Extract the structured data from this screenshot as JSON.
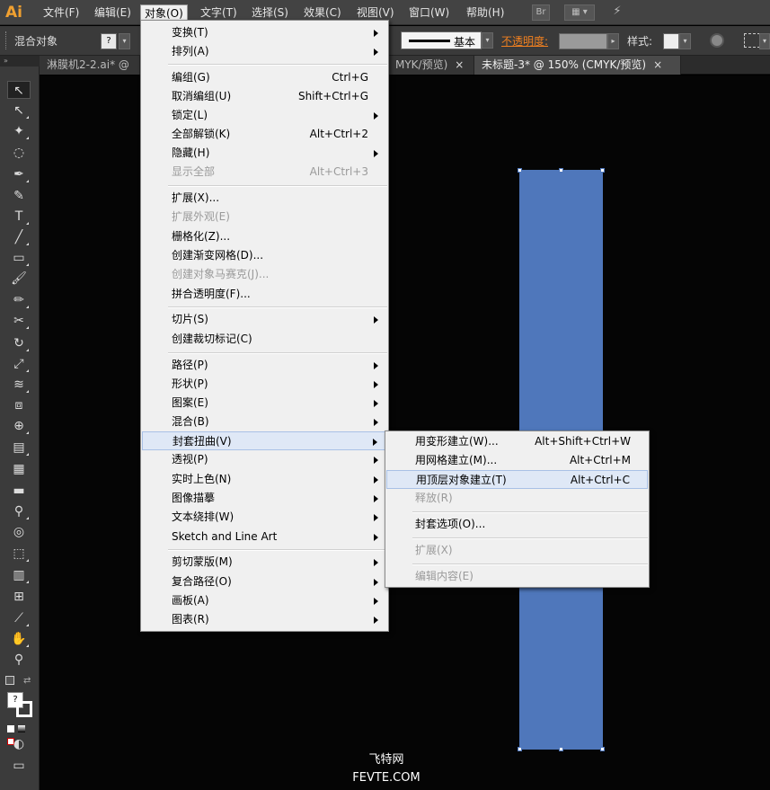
{
  "app": {
    "logo": "Ai"
  },
  "menubar": {
    "items": [
      "文件(F)",
      "编辑(E)",
      "对象(O)",
      "文字(T)",
      "选择(S)",
      "效果(C)",
      "视图(V)",
      "窗口(W)",
      "帮助(H)"
    ],
    "bridge_label": "Br"
  },
  "controlbar": {
    "selection_label": "混合对象",
    "stroke_profile": "基本",
    "opacity_label": "不透明度:",
    "style_label": "样式:"
  },
  "tabs": [
    {
      "label": "淋膜机2-2.ai* @"
    },
    {
      "label": "MYK/预览)",
      "close": "×"
    },
    {
      "label": "未标题-3* @ 150% (CMYK/预览)",
      "close": "×"
    }
  ],
  "object_menu": {
    "items": [
      {
        "label": "变换(T)",
        "submenu": true
      },
      {
        "label": "排列(A)",
        "submenu": true
      },
      {
        "label": "编组(G)",
        "shortcut": "Ctrl+G"
      },
      {
        "label": "取消编组(U)",
        "shortcut": "Shift+Ctrl+G"
      },
      {
        "label": "锁定(L)",
        "submenu": true
      },
      {
        "label": "全部解锁(K)",
        "shortcut": "Alt+Ctrl+2"
      },
      {
        "label": "隐藏(H)",
        "submenu": true
      },
      {
        "label": "显示全部",
        "shortcut": "Alt+Ctrl+3",
        "disabled": true
      },
      {
        "label": "扩展(X)..."
      },
      {
        "label": "扩展外观(E)",
        "disabled": true
      },
      {
        "label": "栅格化(Z)..."
      },
      {
        "label": "创建渐变网格(D)..."
      },
      {
        "label": "创建对象马赛克(J)...",
        "disabled": true
      },
      {
        "label": "拼合透明度(F)..."
      },
      {
        "label": "切片(S)",
        "submenu": true
      },
      {
        "label": "创建裁切标记(C)"
      },
      {
        "label": "路径(P)",
        "submenu": true
      },
      {
        "label": "形状(P)",
        "submenu": true
      },
      {
        "label": "图案(E)",
        "submenu": true
      },
      {
        "label": "混合(B)",
        "submenu": true
      },
      {
        "label": "封套扭曲(V)",
        "submenu": true,
        "highlighted": true
      },
      {
        "label": "透视(P)",
        "submenu": true
      },
      {
        "label": "实时上色(N)",
        "submenu": true
      },
      {
        "label": "图像描摹",
        "submenu": true
      },
      {
        "label": "文本绕排(W)",
        "submenu": true
      },
      {
        "label": "Sketch and Line Art",
        "submenu": true
      },
      {
        "label": "剪切蒙版(M)",
        "submenu": true
      },
      {
        "label": "复合路径(O)",
        "submenu": true
      },
      {
        "label": "画板(A)",
        "submenu": true
      },
      {
        "label": "图表(R)",
        "submenu": true
      }
    ]
  },
  "envelope_submenu": {
    "items": [
      {
        "label": "用变形建立(W)...",
        "shortcut": "Alt+Shift+Ctrl+W"
      },
      {
        "label": "用网格建立(M)...",
        "shortcut": "Alt+Ctrl+M"
      },
      {
        "label": "用顶层对象建立(T)",
        "shortcut": "Alt+Ctrl+C",
        "highlighted": true
      },
      {
        "label": "释放(R)",
        "disabled": true
      },
      {
        "label": "封套选项(O)..."
      },
      {
        "label": "扩展(X)",
        "disabled": true
      },
      {
        "label": "编辑内容(E)",
        "disabled": true
      }
    ]
  },
  "watermark": {
    "line1": "飞特网",
    "line2": "FEVTE.COM"
  },
  "colors": {
    "accent_blue": "#4f77bb",
    "menu_bg": "#f0f0f0",
    "logo_orange": "#f0a030"
  }
}
